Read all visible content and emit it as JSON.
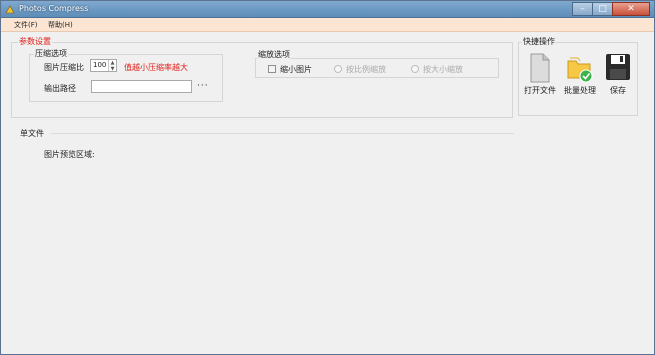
{
  "window": {
    "title": "Photos Compress"
  },
  "menu": {
    "file": "文件(F)",
    "help": "帮助(H)"
  },
  "params": {
    "title": "参数设置",
    "compression": {
      "title": "压缩选项",
      "ratio_label": "图片压缩比",
      "ratio_value": "100",
      "ratio_note": "值越小压缩率越大",
      "output_label": "输出路径",
      "output_value": "",
      "browse_label": "···"
    },
    "scale": {
      "title": "缩放选项",
      "shrink_label": "缩小图片",
      "shrink_checked": false,
      "by_ratio_label": "按比例缩放",
      "by_size_label": "按大小缩放"
    }
  },
  "quick_actions": {
    "title": "快捷操作",
    "open_label": "打开文件",
    "batch_label": "批量处理",
    "save_label": "保存"
  },
  "single_file": {
    "title": "单文件",
    "preview_label": "图片预览区域:"
  },
  "colors": {
    "titlebar": "#6f9bc4",
    "menubar": "#fce5d2",
    "accent_red": "#e0201a",
    "window_bg": "#f0f0f0"
  }
}
